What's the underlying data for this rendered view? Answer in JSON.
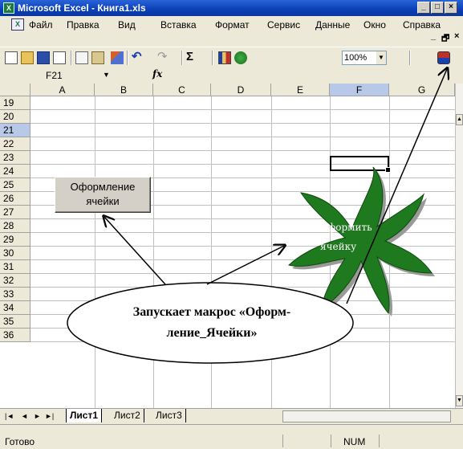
{
  "window": {
    "title": "Microsoft Excel - Книга1.xls",
    "app_icon": "excel-icon",
    "controls": [
      "minimize",
      "maximize",
      "close"
    ]
  },
  "menu": {
    "items": [
      "Файл",
      "Правка",
      "Вид",
      "Вставка",
      "Формат",
      "Сервис",
      "Данные",
      "Окно",
      "Справка"
    ]
  },
  "toolbar": {
    "zoom": "100%",
    "icons": [
      "new-icon",
      "open-icon",
      "save-icon",
      "permission-icon",
      "copy-icon",
      "paste-icon",
      "format-painter-icon",
      "undo-icon",
      "redo-icon",
      "autosum-icon",
      "chart-wizard-icon",
      "drawing-icon",
      "macro-security-icon"
    ]
  },
  "formula_bar": {
    "name_box": "F21",
    "fx": "fx"
  },
  "grid": {
    "columns": [
      "A",
      "B",
      "C",
      "D",
      "E",
      "F",
      "G"
    ],
    "rows": [
      "19",
      "20",
      "21",
      "22",
      "23",
      "24",
      "25",
      "26",
      "27",
      "28",
      "29",
      "30",
      "31",
      "32",
      "33",
      "34",
      "35",
      "36"
    ],
    "selected_column": "F",
    "selected_row": "21"
  },
  "sheet_button": {
    "line1": "Оформление",
    "line2": "ячейки"
  },
  "star_shape": {
    "line1": "Оформить",
    "line2": "ячейку",
    "color": "#1f7a1f"
  },
  "callout": {
    "line1": "Запускает макрос «Оформ-",
    "line2": "ление_Ячейки»"
  },
  "tabs": {
    "items": [
      "Лист1",
      "Лист2",
      "Лист3"
    ],
    "active": "Лист1"
  },
  "status": {
    "text": "Готово",
    "num": "NUM"
  }
}
